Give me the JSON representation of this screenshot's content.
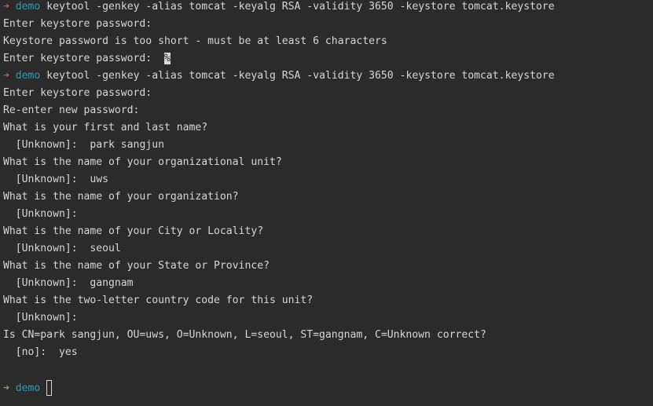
{
  "colors": {
    "background": "#2b2b2b",
    "text": "#d6d6d6",
    "arrow_error": "#e55049",
    "arrow_ok": "#79b83c",
    "directory": "#17a4c0"
  },
  "prompt": {
    "arrow": "➜",
    "arrow_error_icon": "right-arrow-icon-red",
    "arrow_ok_icon": "right-arrow-icon-green",
    "directory": "demo"
  },
  "commands": {
    "first": "keytool -genkey -alias tomcat -keyalg RSA -validity 3650 -keystore tomcat.keystore",
    "second": "keytool -genkey -alias tomcat -keyalg RSA -validity 3650 -keystore tomcat.keystore"
  },
  "output": {
    "enter_pw_1": "Enter keystore password:",
    "too_short": "Keystore password is too short - must be at least 6 characters",
    "enter_pw_2": "Enter keystore password:",
    "percent_mark": "%",
    "enter_pw_3": "Enter keystore password:",
    "reenter_pw": "Re-enter new password:",
    "q_name": "What is your first and last name?",
    "a_name_prefix": "  [Unknown]:  ",
    "a_name": "park sangjun",
    "q_unit": "What is the name of your organizational unit?",
    "a_unit_prefix": "  [Unknown]:  ",
    "a_unit": "uws",
    "q_org": "What is the name of your organization?",
    "a_org_prefix": "  [Unknown]:",
    "q_city": "What is the name of your City or Locality?",
    "a_city_prefix": "  [Unknown]:  ",
    "a_city": "seoul",
    "q_state": "What is the name of your State or Province?",
    "a_state_prefix": "  [Unknown]:  ",
    "a_state": "gangnam",
    "q_country": "What is the two-letter country code for this unit?",
    "a_country_prefix": "  [Unknown]:",
    "confirm": "Is CN=park sangjun, OU=uws, O=Unknown, L=seoul, ST=gangnam, C=Unknown correct?",
    "a_confirm_prefix": "  [no]:  ",
    "a_confirm": "yes"
  }
}
